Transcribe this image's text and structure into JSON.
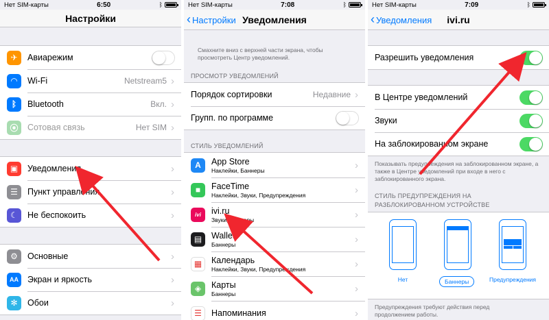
{
  "screen1": {
    "status": {
      "carrier": "Нет SIM-карты",
      "time": "6:50"
    },
    "title": "Настройки",
    "group1": [
      {
        "label": "Авиарежим",
        "icon": "airplane-icon",
        "color": "#ff9500",
        "glyph": "✈",
        "toggle": "off"
      },
      {
        "label": "Wi-Fi",
        "icon": "wifi-icon",
        "color": "#007aff",
        "glyph": "◠",
        "value": "Netstream5"
      },
      {
        "label": "Bluetooth",
        "icon": "bluetooth-icon",
        "color": "#007aff",
        "glyph": "ᛒ",
        "value": "Вкл."
      },
      {
        "label": "Сотовая связь",
        "icon": "cellular-icon",
        "color": "#a8dcb0",
        "glyph": "⦿",
        "value": "Нет SIM",
        "dim": true
      }
    ],
    "group2": [
      {
        "label": "Уведомления",
        "icon": "notifications-icon",
        "color": "#ff3b30",
        "glyph": "▣"
      },
      {
        "label": "Пункт управления",
        "icon": "control-center-icon",
        "color": "#8e8e93",
        "glyph": "☰"
      },
      {
        "label": "Не беспокоить",
        "icon": "do-not-disturb-icon",
        "color": "#5856d6",
        "glyph": "☾"
      }
    ],
    "group3": [
      {
        "label": "Основные",
        "icon": "gear-icon",
        "color": "#8e8e93",
        "glyph": "⚙"
      },
      {
        "label": "Экран и яркость",
        "icon": "display-icon",
        "color": "#007aff",
        "glyph": "AA"
      },
      {
        "label": "Обои",
        "icon": "wallpaper-icon",
        "color": "#2fb6e8",
        "glyph": "✻"
      }
    ]
  },
  "screen2": {
    "status": {
      "carrier": "Нет SIM-карты",
      "time": "7:08"
    },
    "back": "Настройки",
    "title": "Уведомления",
    "intro": "Смахните вниз с верхней части экрана, чтобы просмотреть Центр уведомлений.",
    "view_header": "ПРОСМОТР УВЕДОМЛЕНИЙ",
    "sort": {
      "label": "Порядок сортировки",
      "value": "Недавние"
    },
    "group_by": {
      "label": "Групп. по программе"
    },
    "style_header": "СТИЛЬ УВЕДОМЛЕНИЙ",
    "apps": [
      {
        "name": "App Store",
        "sub": "Наклейки, Баннеры",
        "icon": "app-store-icon",
        "color": "#1e88f5",
        "glyph": "A"
      },
      {
        "name": "FaceTime",
        "sub": "Наклейки, Звуки, Предупреждения",
        "icon": "facetime-icon",
        "color": "#34c759",
        "glyph": "■"
      },
      {
        "name": "ivi.ru",
        "sub": "Звуки, Баннеры",
        "icon": "ivi-icon",
        "color": "#ea0a5b",
        "glyph": "ivi"
      },
      {
        "name": "Wallet",
        "sub": "Баннеры",
        "icon": "wallet-icon",
        "color": "#1c1c1e",
        "glyph": "▤"
      },
      {
        "name": "Календарь",
        "sub": "Наклейки, Звуки, Предупреждения",
        "icon": "calendar-icon",
        "color": "#ffffff",
        "glyph": "▦"
      },
      {
        "name": "Карты",
        "sub": "Баннеры",
        "icon": "maps-icon",
        "color": "#6ac46a",
        "glyph": "◈"
      },
      {
        "name": "Напоминания",
        "sub": "",
        "icon": "reminders-icon",
        "color": "#ffffff",
        "glyph": "☰"
      }
    ]
  },
  "screen3": {
    "status": {
      "carrier": "Нет SIM-карты",
      "time": "7:09"
    },
    "back": "Уведомления",
    "title": "ivi.ru",
    "allow": {
      "label": "Разрешить уведомления"
    },
    "options": [
      {
        "label": "В Центре уведомлений"
      },
      {
        "label": "Звуки"
      },
      {
        "label": "На заблокированном экране"
      }
    ],
    "lock_note": "Показывать предупреждения на заблокированном экране, а также в Центре уведомлений при входе в него с заблокированного экрана.",
    "style_header_1": "СТИЛЬ ПРЕДУПРЕЖДЕНИЯ НА",
    "style_header_2": "РАЗБЛОКИРОВАННОМ УСТРОЙСТВЕ",
    "styles": [
      {
        "label": "Нет"
      },
      {
        "label": "Баннеры",
        "selected": true
      },
      {
        "label": "Предупреждения"
      }
    ],
    "footer_1": "Предупреждения требуют действия перед",
    "footer_2": "продолжением работы."
  },
  "colors": {
    "accent": "#007aff",
    "toggle_on": "#4cd964",
    "arrow": "#f0262e"
  }
}
